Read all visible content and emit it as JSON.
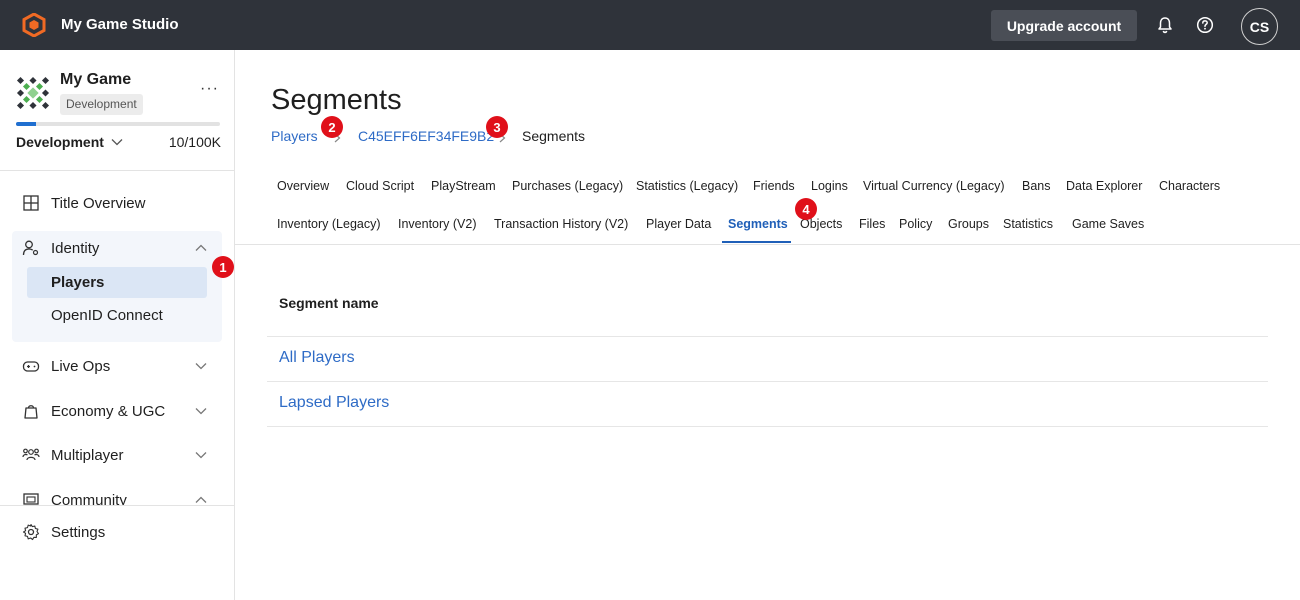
{
  "topbar": {
    "app_title": "My Game Studio",
    "upgrade_label": "Upgrade account",
    "avatar_initials": "CS"
  },
  "sidebar": {
    "game_name": "My Game",
    "env_badge": "Development",
    "env_select": "Development",
    "usage": "10/100K",
    "usage_fraction": 0.1,
    "items": {
      "title_overview": "Title Overview",
      "identity": "Identity",
      "players": "Players",
      "openid": "OpenID Connect",
      "live_ops": "Live Ops",
      "economy": "Economy & UGC",
      "multiplayer": "Multiplayer",
      "community": "Community",
      "settings": "Settings"
    }
  },
  "badges": [
    "1",
    "2",
    "3",
    "4"
  ],
  "main": {
    "title": "Segments",
    "breadcrumb": {
      "players": "Players",
      "player_id": "C45EFF6EF34FE9B2",
      "current": "Segments"
    },
    "tabs_row1": [
      "Overview",
      "Cloud Script",
      "PlayStream",
      "Purchases (Legacy)",
      "Statistics (Legacy)",
      "Friends",
      "Logins",
      "Virtual Currency (Legacy)",
      "Bans",
      "Data Explorer",
      "Characters"
    ],
    "tabs_row2": [
      "Inventory (Legacy)",
      "Inventory (V2)",
      "Transaction History (V2)",
      "Player Data",
      "Segments",
      "Objects",
      "Files",
      "Policy",
      "Groups",
      "Statistics",
      "Game Saves"
    ],
    "active_tab": "Segments",
    "table": {
      "header": "Segment name",
      "rows": [
        "All Players",
        "Lapsed Players"
      ]
    }
  },
  "colors": {
    "topbar_bg": "#2f333a",
    "accent": "#1f5fb8",
    "link": "#2e6bc6",
    "badge": "#e0101a",
    "logo": "#f06a24"
  }
}
